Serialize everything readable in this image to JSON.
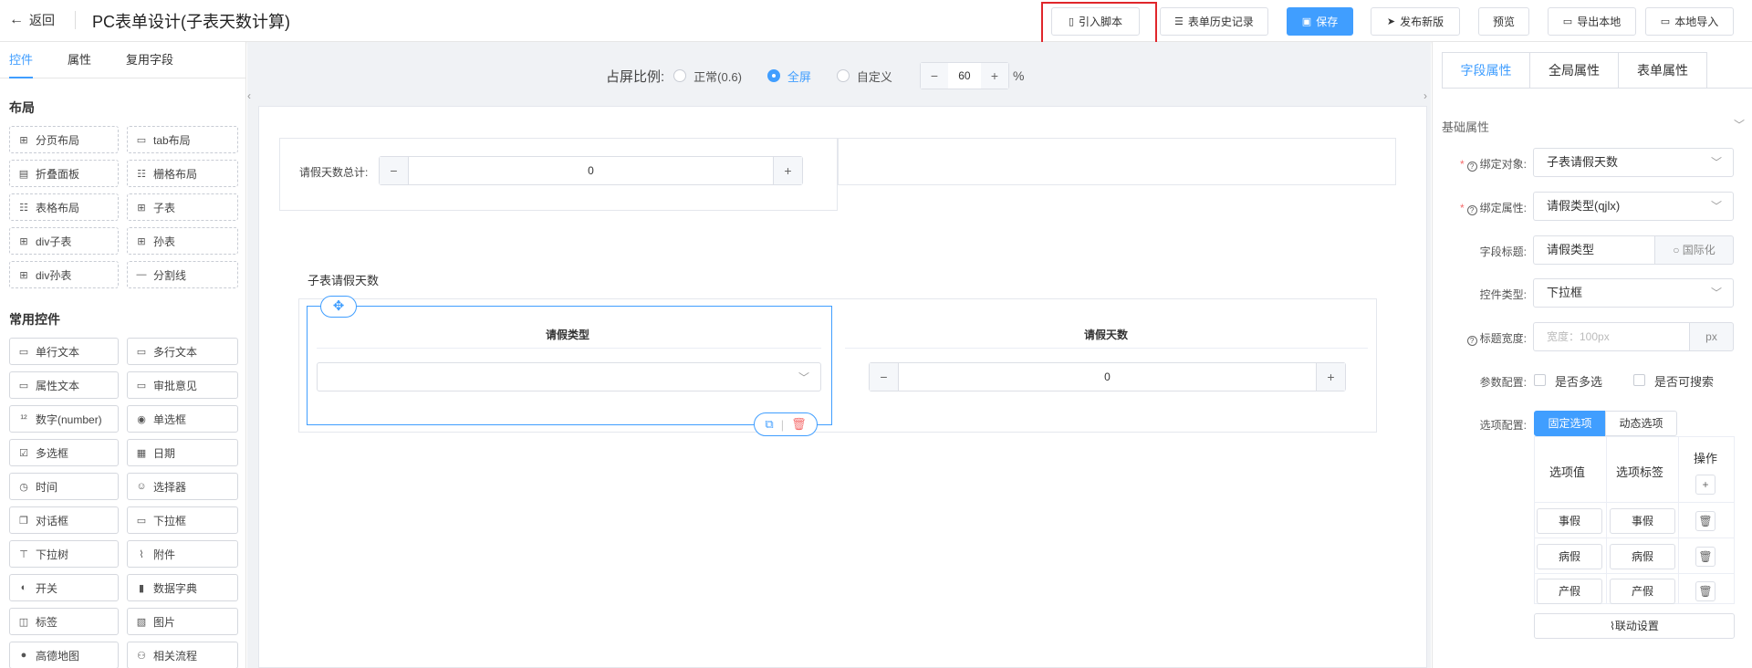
{
  "header": {
    "back_label": "返回",
    "title": "PC表单设计(子表天数计算)",
    "buttons": {
      "import_script": "引入脚本",
      "history": "表单历史记录",
      "save": "保存",
      "publish": "发布新版",
      "preview": "预览",
      "export": "导出本地",
      "import_local": "本地导入"
    }
  },
  "left_panel": {
    "tabs": [
      "控件",
      "属性",
      "复用字段"
    ],
    "layout_title": "布局",
    "layout_items": [
      {
        "icon": "page-layout-icon",
        "label": "分页布局"
      },
      {
        "icon": "tab-layout-icon",
        "label": "tab布局"
      },
      {
        "icon": "collapse-icon",
        "label": "折叠面板"
      },
      {
        "icon": "grid-icon",
        "label": "栅格布局"
      },
      {
        "icon": "table-layout-icon",
        "label": "表格布局"
      },
      {
        "icon": "subtable-icon",
        "label": "子表"
      },
      {
        "icon": "div-subtable-icon",
        "label": "div子表"
      },
      {
        "icon": "grandchild-table-icon",
        "label": "孙表"
      },
      {
        "icon": "div-grandchild-icon",
        "label": "div孙表"
      },
      {
        "icon": "divider-icon",
        "label": "分割线"
      }
    ],
    "common_title": "常用控件",
    "common_items": [
      {
        "icon": "text-input-icon",
        "label": "单行文本"
      },
      {
        "icon": "textarea-icon",
        "label": "多行文本"
      },
      {
        "icon": "attr-text-icon",
        "label": "属性文本"
      },
      {
        "icon": "approval-icon",
        "label": "审批意见"
      },
      {
        "icon": "number-icon",
        "label": "数字(number)"
      },
      {
        "icon": "radio-icon",
        "label": "单选框"
      },
      {
        "icon": "checkbox-icon",
        "label": "多选框"
      },
      {
        "icon": "date-icon",
        "label": "日期"
      },
      {
        "icon": "clock-icon",
        "label": "时间"
      },
      {
        "icon": "selector-icon",
        "label": "选择器"
      },
      {
        "icon": "dialog-icon",
        "label": "对话框"
      },
      {
        "icon": "dropdown-icon",
        "label": "下拉框"
      },
      {
        "icon": "tree-icon",
        "label": "下拉树"
      },
      {
        "icon": "attachment-icon",
        "label": "附件"
      },
      {
        "icon": "switch-icon",
        "label": "开关"
      },
      {
        "icon": "dictionary-icon",
        "label": "数据字典"
      },
      {
        "icon": "tag-icon",
        "label": "标签"
      },
      {
        "icon": "image-icon",
        "label": "图片"
      },
      {
        "icon": "map-pin-icon",
        "label": "高德地图"
      },
      {
        "icon": "flow-icon",
        "label": "相关流程"
      }
    ]
  },
  "canvas": {
    "ratio_label": "占屏比例:",
    "ratio_options": [
      "正常(0.6)",
      "全屏",
      "自定义"
    ],
    "ratio_selected": "全屏",
    "custom_value": "60",
    "percent": "%",
    "total_days_label": "请假天数总计:",
    "total_days_value": "0",
    "subtable_title": "子表请假天数",
    "columns": [
      "请假类型",
      "请假天数"
    ],
    "days_value": "0"
  },
  "right_panel": {
    "tabs": [
      "字段属性",
      "全局属性",
      "表单属性"
    ],
    "active_tab": "字段属性",
    "basic_title": "基础属性",
    "bind_object_label": "绑定对象:",
    "bind_object_value": "子表请假天数",
    "bind_attr_label": "绑定属性:",
    "bind_attr_value": "请假类型(qjlx)",
    "field_title_label": "字段标题:",
    "field_title_value": "请假类型",
    "i18n_label": "国际化",
    "control_type_label": "控件类型:",
    "control_type_value": "下拉框",
    "title_width_label": "标题宽度:",
    "title_width_placeholder": "宽度：100px",
    "px": "px",
    "param_label": "参数配置:",
    "multi_select": "是否多选",
    "searchable": "是否可搜索",
    "option_label": "选项配置:",
    "fixed_options": "固定选项",
    "dynamic_options": "动态选项",
    "table_headers": [
      "选项值",
      "选项标签",
      "操作"
    ],
    "options": [
      {
        "value": "事假",
        "label": "事假"
      },
      {
        "value": "病假",
        "label": "病假"
      },
      {
        "value": "产假",
        "label": "产假"
      }
    ],
    "linkage_label": "联动设置"
  },
  "colors": {
    "primary": "#409eff",
    "danger": "#f56c6c",
    "highlight": "#e0262b"
  }
}
